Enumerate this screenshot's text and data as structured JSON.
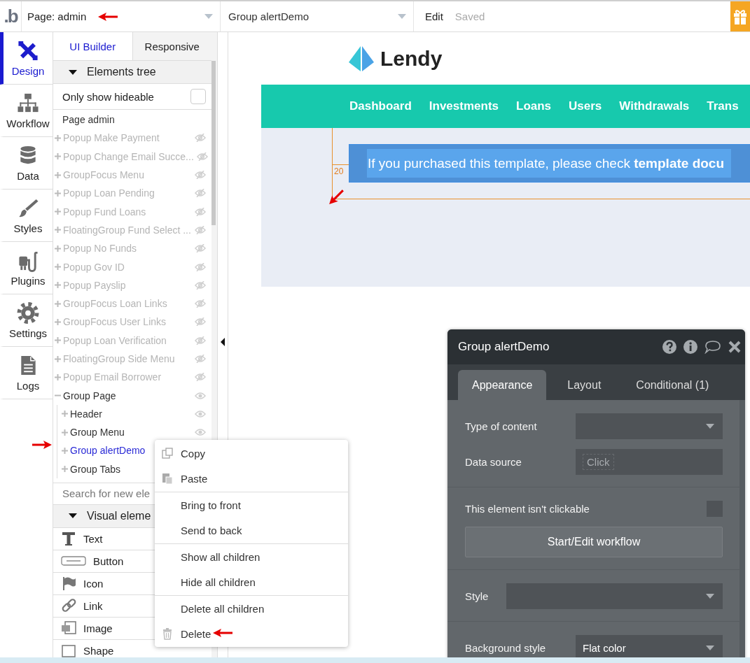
{
  "top_bar": {
    "logo": ".b",
    "page_selector": "Page: admin",
    "element_selector": "Group alertDemo",
    "edit_label": "Edit",
    "save_status": "Saved"
  },
  "nav": [
    {
      "label": "Design",
      "selected": true
    },
    {
      "label": "Workflow",
      "selected": false
    },
    {
      "label": "Data",
      "selected": false
    },
    {
      "label": "Styles",
      "selected": false
    },
    {
      "label": "Plugins",
      "selected": false
    },
    {
      "label": "Settings",
      "selected": false
    },
    {
      "label": "Logs",
      "selected": false
    }
  ],
  "panel": {
    "tabs": [
      {
        "label": "UI Builder",
        "selected": true
      },
      {
        "label": "Responsive",
        "selected": false
      }
    ],
    "tree_header": {
      "label": "Elements tree",
      "expanded": true
    },
    "filter": {
      "label": "Only show hideable",
      "checked": false
    },
    "tree": {
      "label": "Page admin",
      "children": [
        {
          "label": "Popup Make Payment",
          "hidden": true,
          "expanded": false,
          "selected": false
        },
        {
          "label": "Popup Change Email Succe...",
          "hidden": true,
          "expanded": false,
          "selected": false
        },
        {
          "label": "GroupFocus Menu",
          "hidden": true,
          "expanded": false,
          "selected": false
        },
        {
          "label": "Popup Loan Pending",
          "hidden": true,
          "expanded": false,
          "selected": false
        },
        {
          "label": "Popup Fund Loans",
          "hidden": true,
          "expanded": false,
          "selected": false
        },
        {
          "label": "FloatingGroup Fund Select ...",
          "hidden": true,
          "expanded": false,
          "selected": false
        },
        {
          "label": "Popup No Funds",
          "hidden": true,
          "expanded": false,
          "selected": false
        },
        {
          "label": "Popup Gov ID",
          "hidden": true,
          "expanded": false,
          "selected": false
        },
        {
          "label": "Popup Payslip",
          "hidden": true,
          "expanded": false,
          "selected": false
        },
        {
          "label": "GroupFocus Loan Links",
          "hidden": true,
          "expanded": false,
          "selected": false
        },
        {
          "label": "GroupFocus User Links",
          "hidden": true,
          "expanded": false,
          "selected": false
        },
        {
          "label": "Popup Loan Verification",
          "hidden": true,
          "expanded": false,
          "selected": false
        },
        {
          "label": "FloatingGroup Side Menu",
          "hidden": true,
          "expanded": false,
          "selected": false
        },
        {
          "label": "Popup Email Borrower",
          "hidden": true,
          "expanded": false,
          "selected": false
        },
        {
          "label": "Group Page",
          "hidden": false,
          "expanded": true,
          "selected": false,
          "children": [
            {
              "label": "Header",
              "hidden": false,
              "expanded": false,
              "selected": false
            },
            {
              "label": "Group Menu",
              "hidden": false,
              "expanded": false,
              "selected": false
            },
            {
              "label": "Group alertDemo",
              "hidden": false,
              "expanded": false,
              "selected": true
            },
            {
              "label": "Group Tabs",
              "hidden": false,
              "expanded": false,
              "selected": false
            }
          ]
        }
      ]
    },
    "search": {
      "placeholder": "Search for new ele"
    },
    "visual_header": {
      "label": "Visual eleme",
      "expanded": true
    },
    "elements": [
      "Text",
      "Button",
      "Icon",
      "Link",
      "Image",
      "Shape"
    ]
  },
  "canvas": {
    "brand": "Lendy",
    "nav_links": [
      "Dashboard",
      "Investments",
      "Loans",
      "Users",
      "Withdrawals",
      "Trans"
    ],
    "alert": {
      "text": "If you purchased this template, please check **template docu**"
    },
    "spacing": "20"
  },
  "context_menu": {
    "groups": [
      [
        "Copy",
        "Paste"
      ],
      [
        "Bring to front",
        "Send to back"
      ],
      [
        "Show all children",
        "Hide all children"
      ],
      [
        "Delete all children",
        "Delete"
      ]
    ]
  },
  "property_editor": {
    "title": "Group alertDemo",
    "tabs": [
      {
        "label": "Appearance",
        "selected": true
      },
      {
        "label": "Layout",
        "selected": false
      },
      {
        "label": "Conditional (1)",
        "selected": false
      }
    ],
    "sections": [
      [
        {
          "kind": "dropdown",
          "label": "Type of content"
        },
        {
          "kind": "expression",
          "label": "Data source",
          "value": "Click"
        }
      ],
      [
        {
          "kind": "checkbox",
          "label": "This element isn't clickable",
          "checked": false
        },
        {
          "kind": "button",
          "label": "Start/Edit workflow"
        }
      ],
      [
        {
          "kind": "stylepicker",
          "label": "Style"
        }
      ],
      [
        {
          "kind": "dropdown",
          "label": "Background style",
          "value": "Flat color"
        }
      ]
    ]
  }
}
